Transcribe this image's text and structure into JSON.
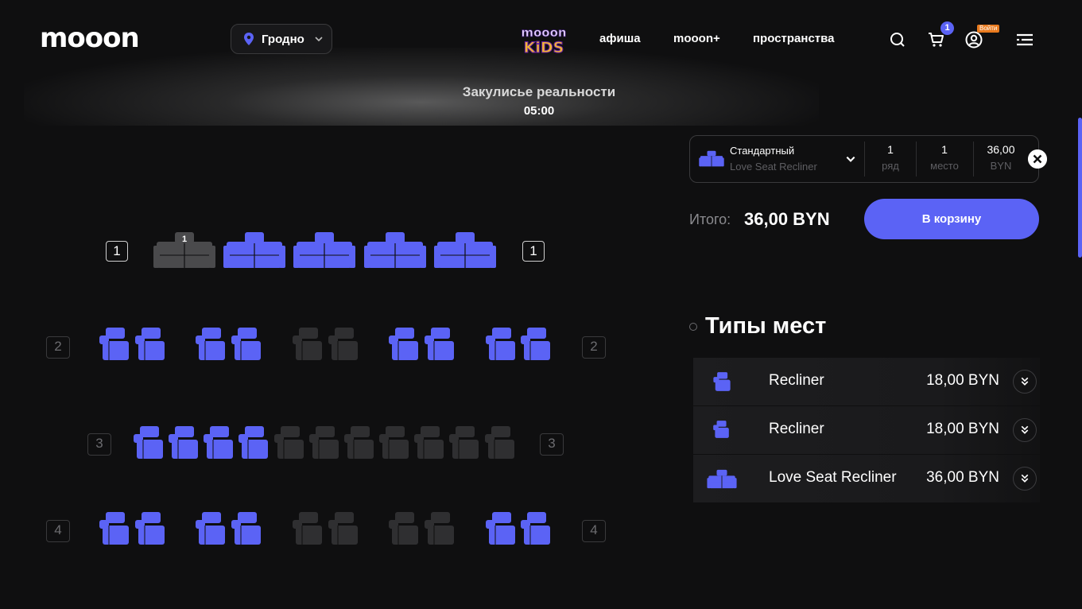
{
  "header": {
    "logo": "mooon",
    "city": "Гродно",
    "nav": [
      "афиша",
      "mooon+",
      "пространства"
    ],
    "cart_count": "1",
    "login_label": "Войти",
    "kids_logo": "mooon KIDS"
  },
  "movie": {
    "title": "Закулисье реальности",
    "time": "05:00"
  },
  "hall": {
    "rows": [
      {
        "label": "1",
        "seat_type": "love-seat",
        "seats": [
          "taken",
          "available",
          "available",
          "available",
          "available"
        ],
        "selected_number": "1"
      },
      {
        "label": "2",
        "seat_type": "recliner",
        "seats": [
          "available",
          "available",
          "available",
          "available",
          "taken",
          "taken",
          "available",
          "available",
          "available",
          "available"
        ]
      },
      {
        "label": "3",
        "seat_type": "recliner",
        "seats": [
          "available",
          "available",
          "available",
          "available",
          "taken",
          "taken",
          "taken",
          "taken",
          "taken",
          "taken",
          "taken"
        ]
      },
      {
        "label": "4",
        "seat_type": "recliner",
        "seats": [
          "available",
          "available",
          "available",
          "available",
          "taken",
          "taken",
          "taken",
          "taken",
          "available",
          "available"
        ]
      }
    ]
  },
  "selection": {
    "type": "Стандартный",
    "subtype": "Love Seat Recliner",
    "row_value": "1",
    "row_label": "ряд",
    "seat_value": "1",
    "seat_label": "место",
    "price_value": "36,00",
    "price_label": "BYN"
  },
  "total": {
    "label": "Итого:",
    "value": "36,00 BYN",
    "button": "В корзину"
  },
  "seat_types": {
    "title": "Типы мест",
    "items": [
      {
        "name": "Recliner",
        "price": "18,00 BYN"
      },
      {
        "name": "Recliner",
        "price": "18,00 BYN"
      },
      {
        "name": "Love Seat Recliner",
        "price": "36,00 BYN"
      }
    ]
  },
  "colors": {
    "accent": "#5b63f5",
    "taken": "#2f2f31",
    "background": "#0f0f10"
  }
}
